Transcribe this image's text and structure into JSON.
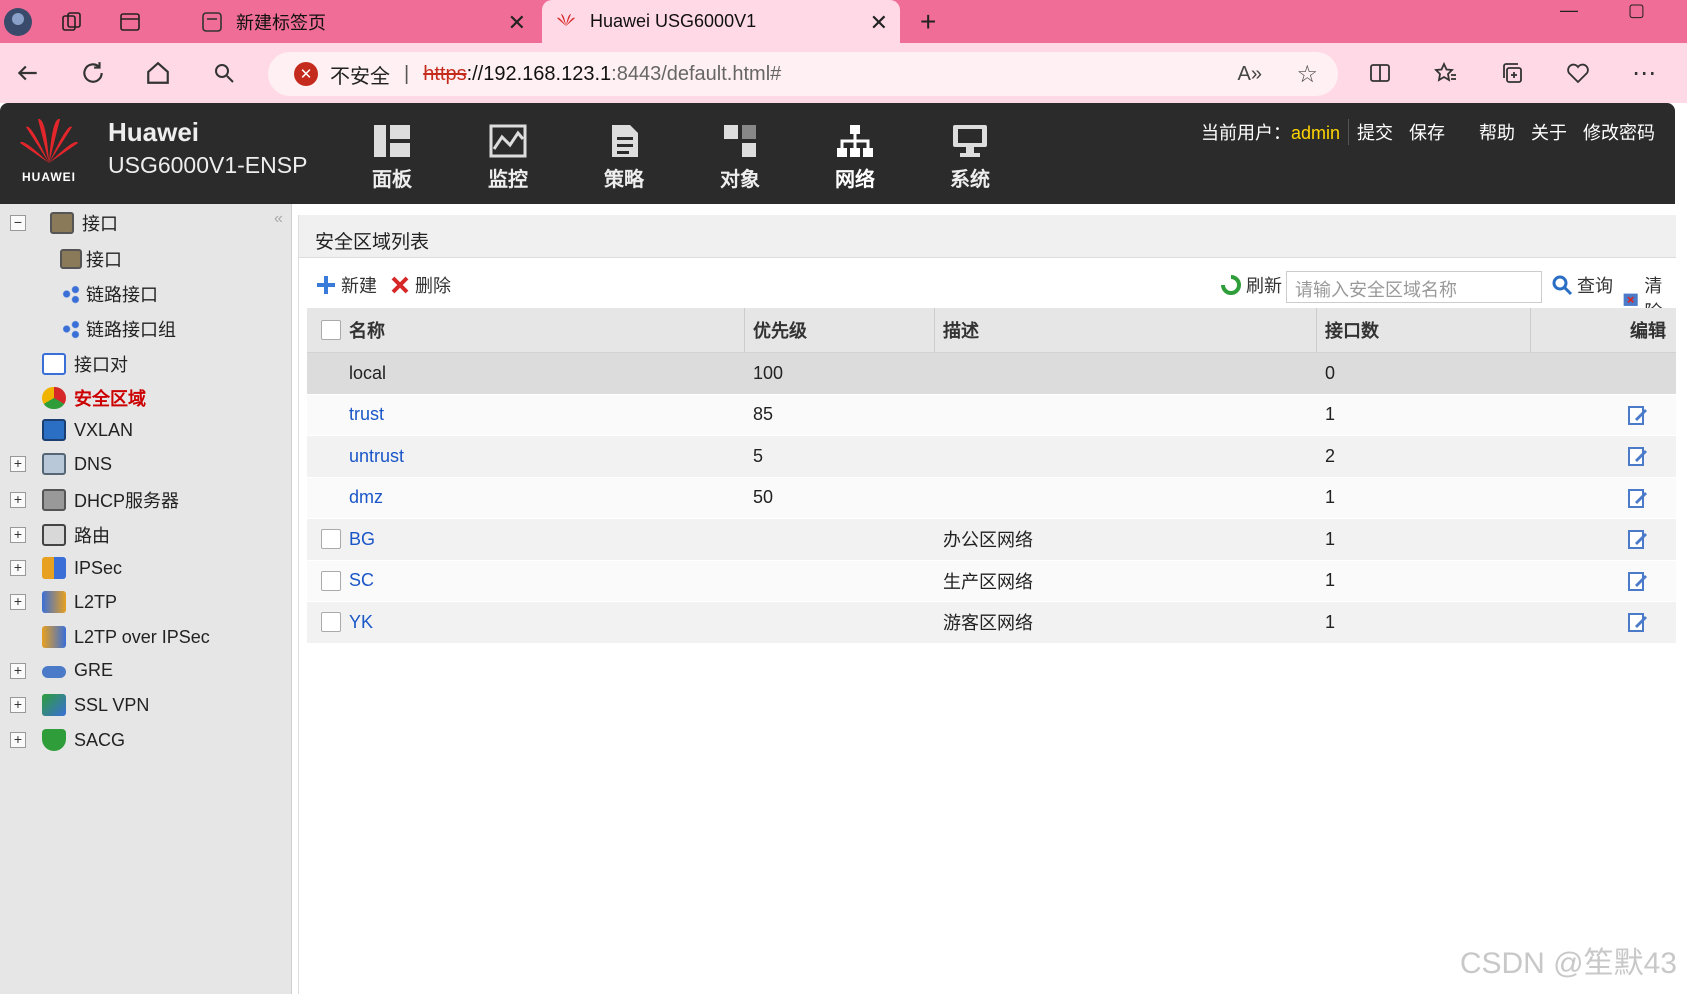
{
  "browser": {
    "tabs": [
      {
        "label": "新建标签页"
      },
      {
        "label": "Huawei USG6000V1"
      }
    ],
    "security_label": "不安全",
    "url_scheme": "https",
    "url_host": "://192.168.123.1",
    "url_path": ":8443/default.html#"
  },
  "header": {
    "brand_name": "Huawei",
    "product": "USG6000V1-ENSP",
    "logo_text": "HUAWEI",
    "nav": [
      {
        "label": "面板",
        "icon": "dashboard-icon"
      },
      {
        "label": "监控",
        "icon": "monitor-icon"
      },
      {
        "label": "策略",
        "icon": "policy-icon"
      },
      {
        "label": "对象",
        "icon": "object-icon"
      },
      {
        "label": "网络",
        "icon": "network-icon"
      },
      {
        "label": "系统",
        "icon": "system-icon"
      }
    ],
    "user_label": "当前用户：",
    "username": "admin",
    "actions": [
      "提交",
      "保存",
      "帮助",
      "关于",
      "修改密码"
    ]
  },
  "sidebar": {
    "items": [
      {
        "label": "接口",
        "expander": "−"
      },
      {
        "label": "接口"
      },
      {
        "label": "链路接口"
      },
      {
        "label": "链路接口组"
      },
      {
        "label": "接口对"
      },
      {
        "label": "安全区域"
      },
      {
        "label": "VXLAN"
      },
      {
        "label": "DNS",
        "expander": "+"
      },
      {
        "label": "DHCP服务器",
        "expander": "+"
      },
      {
        "label": "路由",
        "expander": "+"
      },
      {
        "label": "IPSec",
        "expander": "+"
      },
      {
        "label": "L2TP",
        "expander": "+"
      },
      {
        "label": "L2TP over IPSec"
      },
      {
        "label": "GRE",
        "expander": "+"
      },
      {
        "label": "SSL VPN",
        "expander": "+"
      },
      {
        "label": "SACG",
        "expander": "+"
      }
    ],
    "collapse_glyph": "«"
  },
  "content": {
    "title": "安全区域列表",
    "toolbar": {
      "new_label": "新建",
      "delete_label": "删除",
      "refresh_label": "刷新",
      "search_placeholder": "请输入安全区域名称",
      "query_label": "查询",
      "clear_label": "清除"
    },
    "columns": [
      "名称",
      "优先级",
      "描述",
      "接口数",
      "编辑"
    ],
    "rows": [
      {
        "name": "local",
        "priority": "100",
        "desc": "",
        "ifcount": "0"
      },
      {
        "name": "trust",
        "priority": "85",
        "desc": "",
        "ifcount": "1"
      },
      {
        "name": "untrust",
        "priority": "5",
        "desc": "",
        "ifcount": "2"
      },
      {
        "name": "dmz",
        "priority": "50",
        "desc": "",
        "ifcount": "1"
      },
      {
        "name": "BG",
        "priority": "",
        "desc": "办公区网络",
        "ifcount": "1"
      },
      {
        "name": "SC",
        "priority": "",
        "desc": "生产区网络",
        "ifcount": "1"
      },
      {
        "name": "YK",
        "priority": "",
        "desc": "游客区网络",
        "ifcount": "1"
      }
    ]
  },
  "watermark": "CSDN @笙默43"
}
